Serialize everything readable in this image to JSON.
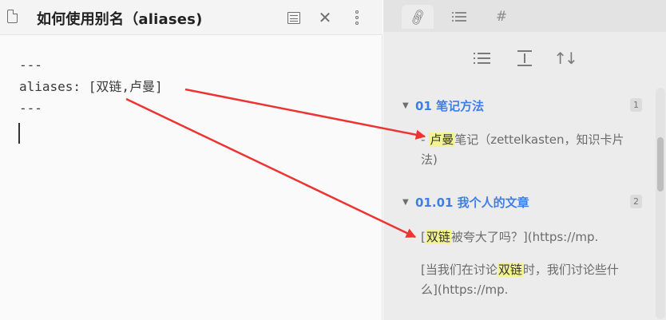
{
  "editor": {
    "title": "如何使用别名（aliases)",
    "lines": [
      "---",
      "aliases: [双链,卢曼]",
      "---"
    ]
  },
  "icons": {
    "file": "file-icon",
    "reading": "reading-view-icon",
    "close": "close-icon",
    "more": "more-options-icon",
    "backlinks": "link-icon",
    "outline": "list-icon",
    "tags": "hash-icon",
    "collapse": "collapse-results-icon",
    "expand": "expand-context-icon",
    "sort": "sort-icon"
  },
  "sidebar": {
    "tags_glyph": "#",
    "sort_glyph": "↑↓",
    "groups": [
      {
        "title": "01 笔记方法",
        "count": "1",
        "matches": [
          {
            "before": "- ",
            "highlight": "卢曼",
            "after": "笔记（zettelkasten，知识卡片法)"
          }
        ]
      },
      {
        "title": "01.01 我个人的文章",
        "count": "2",
        "matches": [
          {
            "before": "[",
            "highlight": "双链",
            "after": "被夸大了吗？](https://mp."
          },
          {
            "before": "[当我们在讨论",
            "highlight": "双链",
            "after": "时，我们讨论些什么](https://mp."
          }
        ]
      }
    ]
  },
  "colors": {
    "accent": "#3f7ee8",
    "highlight": "#f3f394",
    "annotation_arrow": "#ee3333"
  }
}
